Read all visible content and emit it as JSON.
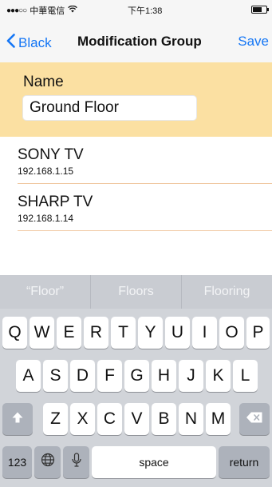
{
  "status_bar": {
    "signal": "●●●○○",
    "carrier": "中華電信",
    "wifi_icon": "wifi-icon",
    "time": "下午1:38",
    "battery_level_percent": 70
  },
  "nav": {
    "back_label": "Black",
    "title": "Modification Group",
    "save_label": "Save"
  },
  "name_section": {
    "label": "Name",
    "value": "Ground Floor",
    "placeholder": ""
  },
  "devices": [
    {
      "name": "SONY TV",
      "ip": "192.168.1.15"
    },
    {
      "name": "SHARP TV",
      "ip": "192.168.1.14"
    }
  ],
  "suggestions": [
    "“Floor”",
    "Floors",
    "Flooring"
  ],
  "keyboard": {
    "row1": [
      "Q",
      "W",
      "E",
      "R",
      "T",
      "Y",
      "U",
      "I",
      "O",
      "P"
    ],
    "row2": [
      "A",
      "S",
      "D",
      "F",
      "G",
      "H",
      "J",
      "K",
      "L"
    ],
    "row3": [
      "Z",
      "X",
      "C",
      "V",
      "B",
      "N",
      "M"
    ],
    "numbers_label": "123",
    "space_label": "space",
    "return_label": "return"
  },
  "colors": {
    "accent": "#1476f5",
    "name_section_bg": "#fbe0a2",
    "divider": "#f0c7a0",
    "keyboard_bg": "#d1d4d9"
  }
}
